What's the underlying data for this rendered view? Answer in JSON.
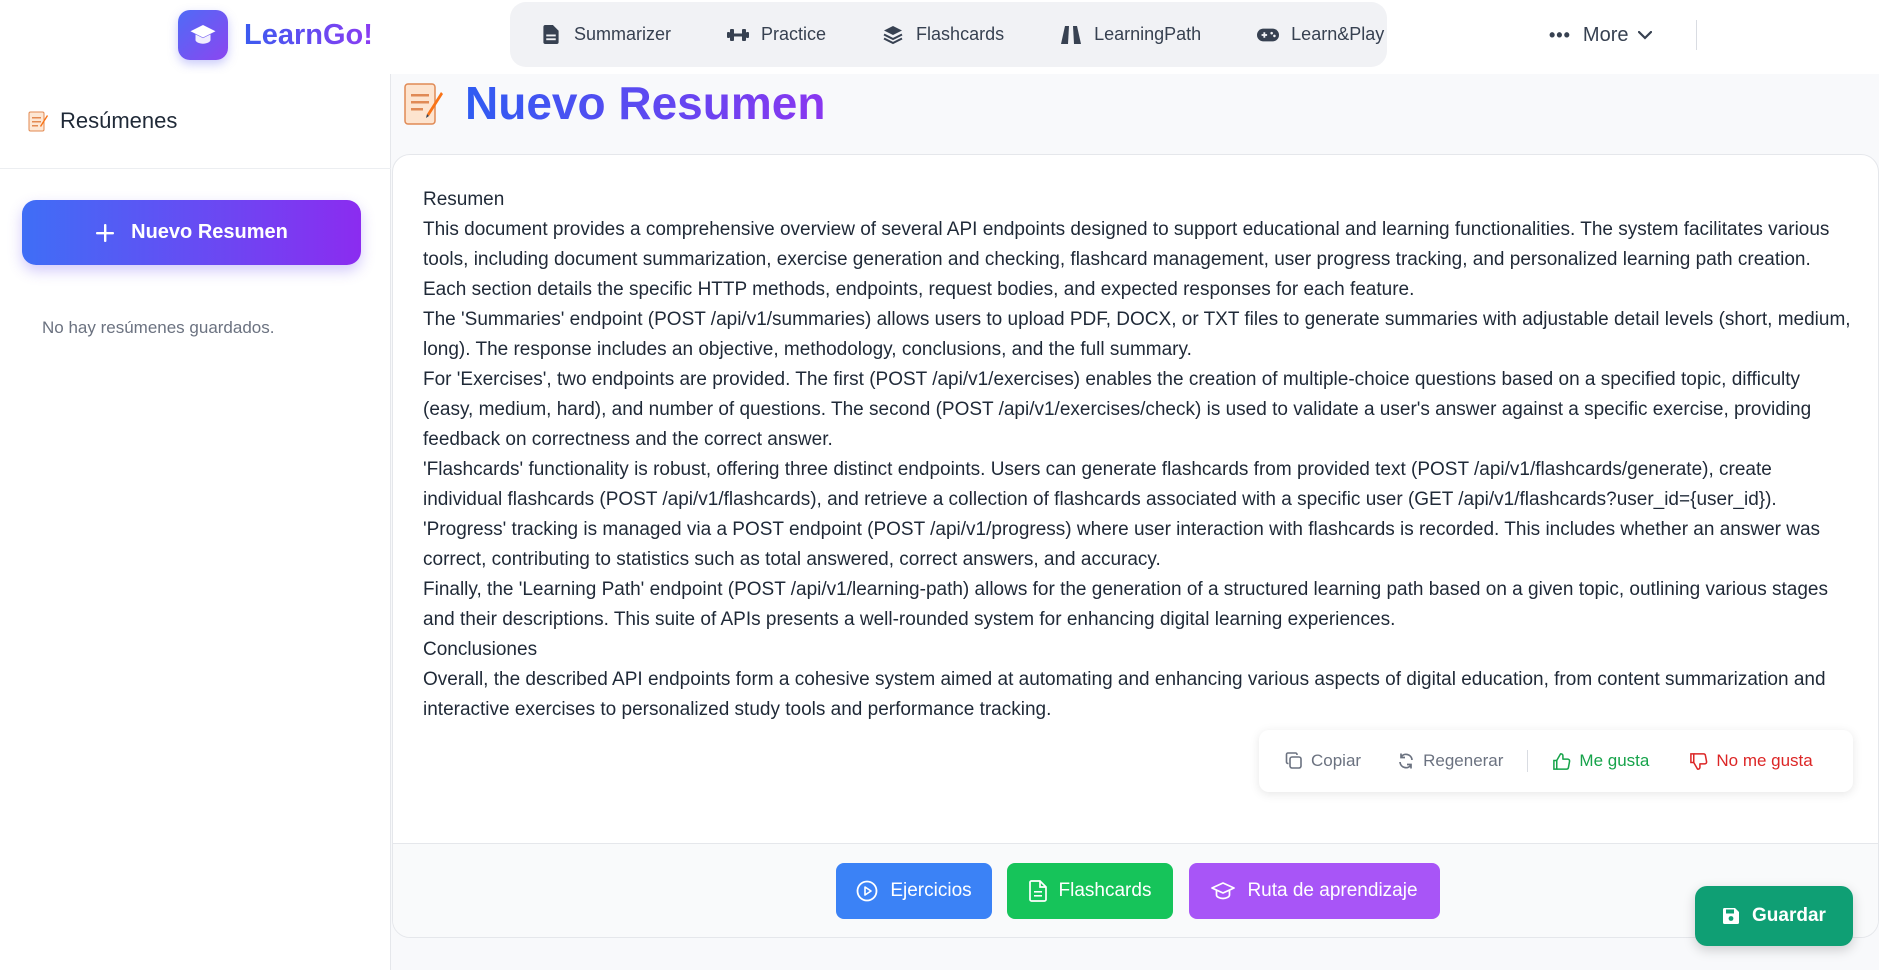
{
  "brand": {
    "name": "LearnGo!"
  },
  "nav": {
    "items": [
      {
        "label": "Summarizer",
        "icon": "document-icon"
      },
      {
        "label": "Practice",
        "icon": "dumbbell-icon"
      },
      {
        "label": "Flashcards",
        "icon": "layers-icon"
      },
      {
        "label": "LearningPath",
        "icon": "path-icon"
      },
      {
        "label": "Learn&Play",
        "icon": "gamepad-icon"
      }
    ],
    "more_label": "More"
  },
  "sidebar": {
    "title": "Resúmenes",
    "new_button_label": "Nuevo Resumen",
    "empty_text": "No hay resúmenes guardados."
  },
  "main": {
    "title": "Nuevo Resumen",
    "summary_lines": [
      "Resumen",
      "This document provides a comprehensive overview of several API endpoints designed to support educational and learning functionalities. The system facilitates various tools, including document summarization, exercise generation and checking, flashcard management, user progress tracking, and personalized learning path creation. Each section details the specific HTTP methods, endpoints, request bodies, and expected responses for each feature.",
      "The 'Summaries' endpoint (POST /api/v1/summaries) allows users to upload PDF, DOCX, or TXT files to generate summaries with adjustable detail levels (short, medium, long). The response includes an objective, methodology, conclusions, and the full summary.",
      "For 'Exercises', two endpoints are provided. The first (POST /api/v1/exercises) enables the creation of multiple-choice questions based on a specified topic, difficulty (easy, medium, hard), and number of questions. The second (POST /api/v1/exercises/check) is used to validate a user's answer against a specific exercise, providing feedback on correctness and the correct answer.",
      "'Flashcards' functionality is robust, offering three distinct endpoints. Users can generate flashcards from provided text (POST /api/v1/flashcards/generate), create individual flashcards (POST /api/v1/flashcards), and retrieve a collection of flashcards associated with a specific user (GET /api/v1/flashcards?user_id={user_id}).",
      "'Progress' tracking is managed via a POST endpoint (POST /api/v1/progress) where user interaction with flashcards is recorded. This includes whether an answer was correct, contributing to statistics such as total answered, correct answers, and accuracy.",
      "Finally, the 'Learning Path' endpoint (POST /api/v1/learning-path) allows for the generation of a structured learning path based on a given topic, outlining various stages and their descriptions. This suite of APIs presents a well-rounded system for enhancing digital learning experiences.",
      "Conclusiones",
      "Overall, the described API endpoints form a cohesive system aimed at automating and enhancing various aspects of digital education, from content summarization and interactive exercises to personalized study tools and performance tracking."
    ],
    "actions": {
      "copy": "Copiar",
      "regenerate": "Regenerar",
      "like": "Me gusta",
      "dislike": "No me gusta"
    },
    "footer_buttons": {
      "exercises": "Ejercicios",
      "flashcards": "Flashcards",
      "learning_path": "Ruta de aprendizaje"
    },
    "save_label": "Guardar"
  },
  "colors": {
    "brand_gradient_start": "#3f6ef6",
    "brand_gradient_end": "#8b2cf0",
    "exercises": "#3b82f6",
    "flashcards": "#16c45a",
    "learning_path": "#a855f7",
    "save": "#0f9f74",
    "like": "#16a34a",
    "dislike": "#dc2626"
  }
}
